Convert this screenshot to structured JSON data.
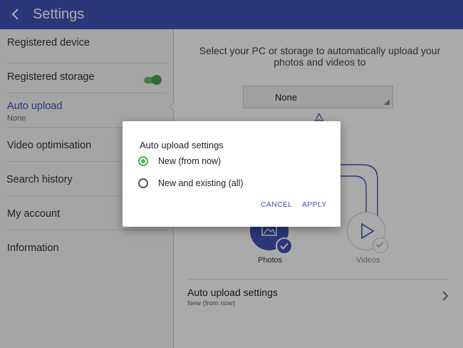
{
  "header": {
    "title": "Settings",
    "back_icon": "arrow-back-icon"
  },
  "sidebar": {
    "items": [
      {
        "label": "Registered device"
      },
      {
        "label": "Registered storage"
      },
      {
        "label": "Auto upload",
        "sub": "None",
        "toggle_on": true
      },
      {
        "label": "Video optimisation"
      },
      {
        "label": "Search history"
      },
      {
        "label": "My account"
      },
      {
        "label": "Information"
      }
    ]
  },
  "main": {
    "description": "Select your PC or storage to automatically upload your photos and videos to",
    "dropdown_value": "None",
    "photos_label": "Photos",
    "videos_label": "Videos",
    "settings_row": {
      "title": "Auto upload settings",
      "subtitle": "New (from now)"
    }
  },
  "dialog": {
    "title": "Auto upload settings",
    "options": [
      {
        "label": "New (from now)",
        "selected": true
      },
      {
        "label": "New and existing (all)",
        "selected": false
      }
    ],
    "cancel_label": "CANCEL",
    "apply_label": "APPLY"
  },
  "colors": {
    "primary": "#3f51b5",
    "toggle": "#3fa547",
    "radio_selected": "#4caf50"
  }
}
